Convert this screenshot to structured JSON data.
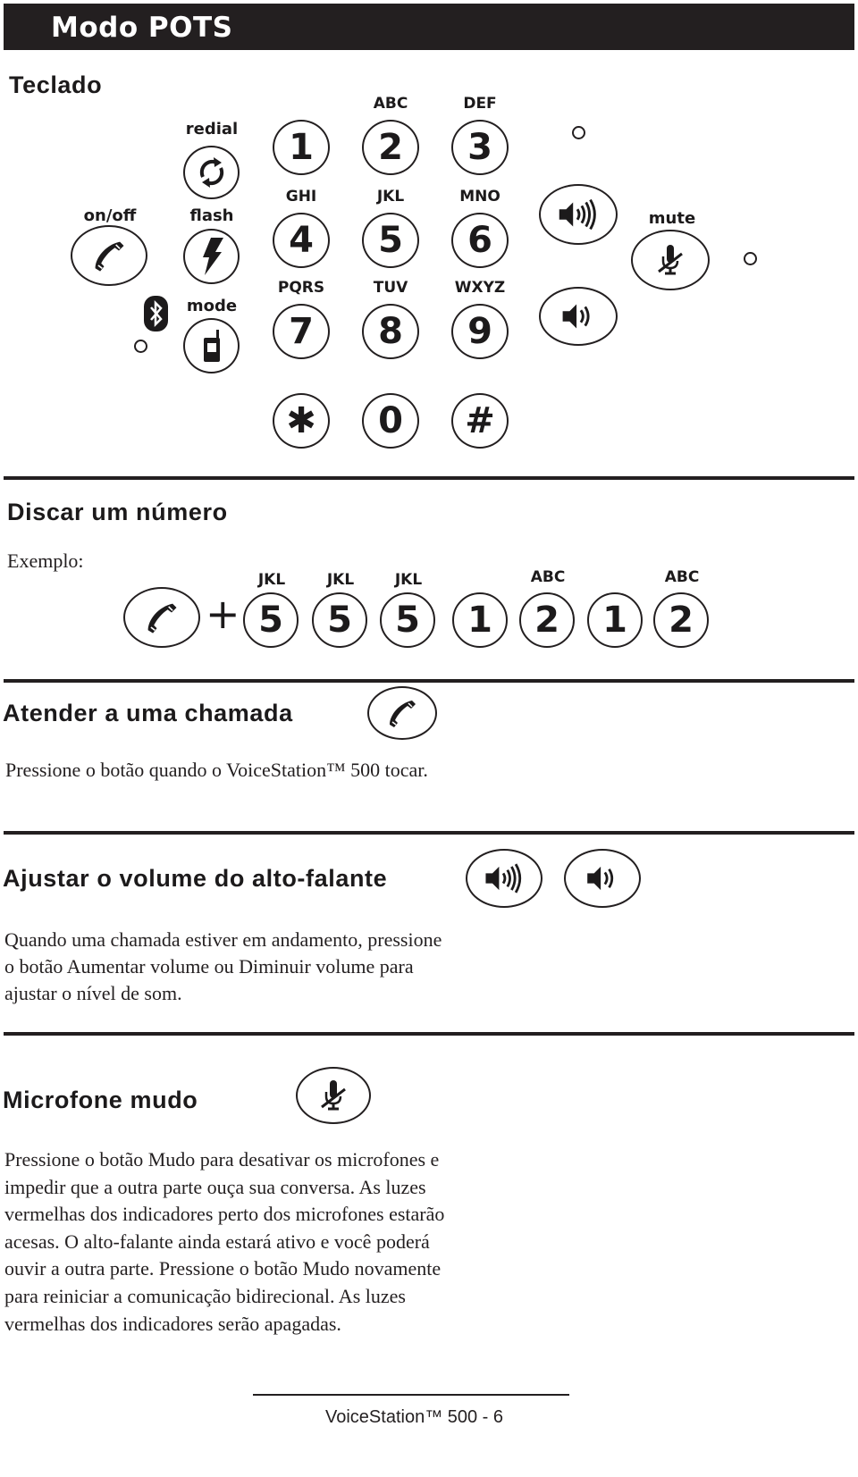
{
  "banner": {
    "title": "Modo POTS"
  },
  "keypad_section": {
    "heading": "Teclado",
    "labels": {
      "redial": "redial",
      "on_off": "on/off",
      "flash": "flash",
      "mode": "mode",
      "mute": "mute"
    },
    "keys": [
      {
        "digit": "1",
        "letters": ""
      },
      {
        "digit": "2",
        "letters": "ABC"
      },
      {
        "digit": "3",
        "letters": "DEF"
      },
      {
        "digit": "4",
        "letters": "GHI"
      },
      {
        "digit": "5",
        "letters": "JKL"
      },
      {
        "digit": "6",
        "letters": "MNO"
      },
      {
        "digit": "7",
        "letters": "PQRS"
      },
      {
        "digit": "8",
        "letters": "TUV"
      },
      {
        "digit": "9",
        "letters": "WXYZ"
      },
      {
        "digit": "✱",
        "letters": ""
      },
      {
        "digit": "0",
        "letters": ""
      },
      {
        "digit": "#",
        "letters": ""
      }
    ],
    "icons": [
      "redial-icon",
      "phone-icon",
      "flash-icon",
      "bluetooth-icon",
      "mobile-phone-icon",
      "volume-up-icon",
      "volume-down-icon",
      "mute-microphone-icon"
    ]
  },
  "dial_section": {
    "heading": "Discar um número",
    "example_label": "Exemplo:",
    "plus": "+",
    "sequence": [
      {
        "digit": "5",
        "letters": "JKL"
      },
      {
        "digit": "5",
        "letters": "JKL"
      },
      {
        "digit": "5",
        "letters": "JKL"
      },
      {
        "digit": "1",
        "letters": ""
      },
      {
        "digit": "2",
        "letters": "ABC"
      },
      {
        "digit": "1",
        "letters": ""
      },
      {
        "digit": "2",
        "letters": "ABC"
      }
    ]
  },
  "answer_section": {
    "heading": "Atender a uma chamada",
    "text": "Pressione o botão quando o VoiceStation™ 500 tocar."
  },
  "volume_section": {
    "heading": "Ajustar o volume do alto-falante",
    "lines": [
      "Quando uma chamada estiver em andamento, pressione",
      "o botão Aumentar volume ou Diminuir volume para",
      "ajustar o nível de som."
    ]
  },
  "mute_section": {
    "heading": "Microfone mudo",
    "lines": [
      "Pressione o botão Mudo para desativar os microfones e",
      "impedir que a outra parte ouça sua conversa.  As luzes",
      "vermelhas dos indicadores perto dos microfones estarão",
      "acesas.  O alto-falante ainda estará ativo e você poderá",
      "ouvir a outra parte.  Pressione o botão Mudo novamente",
      "para reiniciar a comunicação bidirecional.  As luzes",
      "vermelhas dos indicadores serão apagadas."
    ]
  },
  "footer": {
    "text": "VoiceStation™ 500 - 6"
  }
}
